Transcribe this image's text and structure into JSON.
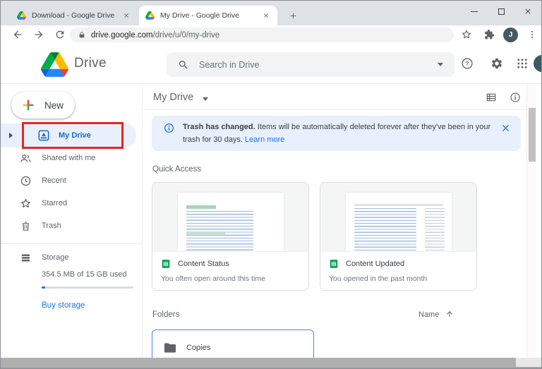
{
  "browser": {
    "tabs": [
      {
        "title": "Download - Google Drive"
      },
      {
        "title": "My Drive - Google Drive"
      }
    ],
    "url_domain": "drive.google.com",
    "url_path": "/drive/u/0/my-drive",
    "avatar_initial": "J"
  },
  "app_header": {
    "app_name": "Drive",
    "search_placeholder": "Search in Drive"
  },
  "sidebar": {
    "new_button_label": "New",
    "items": [
      {
        "label": "My Drive",
        "selected": true
      },
      {
        "label": "Shared with me",
        "selected": false
      },
      {
        "label": "Recent",
        "selected": false
      },
      {
        "label": "Starred",
        "selected": false
      },
      {
        "label": "Trash",
        "selected": false
      }
    ],
    "storage_label": "Storage",
    "storage_usage": "354.5 MB of 15 GB used",
    "buy_storage_label": "Buy storage"
  },
  "main": {
    "title": "My Drive",
    "banner_bold": "Trash has changed.",
    "banner_text": " Items will be automatically deleted forever after they've been in your trash for 30 days. ",
    "banner_link": "Learn more",
    "quick_access_label": "Quick Access",
    "cards": [
      {
        "title": "Content Status",
        "subtitle": "You often open around this time"
      },
      {
        "title": "Content Updated",
        "subtitle": "You opened in the past month"
      }
    ],
    "folders_label": "Folders",
    "sort_label": "Name",
    "folder_items": [
      {
        "name": "Copies"
      }
    ]
  },
  "icons": [
    "drive-logo-icon",
    "close-icon",
    "new-tab-plus-icon",
    "minimize-icon",
    "maximize-icon",
    "back-icon",
    "forward-icon",
    "reload-icon",
    "lock-icon",
    "bookmark-star-icon",
    "extensions-puzzle-icon",
    "more-vert-icon",
    "search-icon",
    "chevron-down-icon",
    "help-icon",
    "gear-icon",
    "apps-grid-icon",
    "multicolor-plus-icon",
    "my-drive-icon",
    "people-icon",
    "clock-icon",
    "star-icon",
    "trash-icon",
    "storage-icon",
    "list-view-icon",
    "info-icon",
    "sheets-icon",
    "folder-icon",
    "arrow-up-icon",
    "expand-right-icon"
  ],
  "colors": {
    "accent_blue": "#1a73e8",
    "selected_text": "#1967d2",
    "selection_bg": "#e8f0fe",
    "banner_bg": "#e8f0fe",
    "annotation_red": "#e5261f",
    "sheets_green": "#0f9d58",
    "avatar_bg": "#455a64",
    "titlebar_bg": "#dee1e6"
  }
}
